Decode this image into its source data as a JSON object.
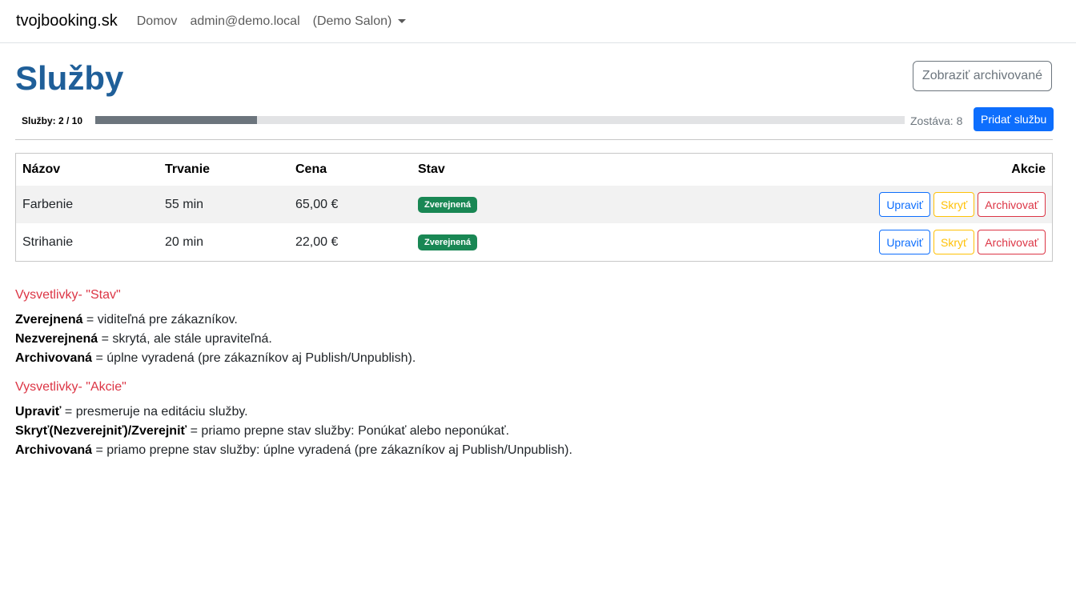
{
  "navbar": {
    "brand": "tvojbooking.sk",
    "home": "Domov",
    "user": "admin@demo.local",
    "salon": "(Demo Salon)"
  },
  "header": {
    "title": "Služby",
    "archived_button": "Zobraziť archivované"
  },
  "quota": {
    "label": "Služby: 2 / 10",
    "used": 2,
    "total": 10,
    "fraction": 0.2,
    "remaining": "Zostáva: 8",
    "add_button": "Pridať službu"
  },
  "table": {
    "columns": [
      "Názov",
      "Trvanie",
      "Cena",
      "Stav",
      "Akcie"
    ],
    "rows": [
      {
        "name": "Farbenie",
        "duration": "55 min",
        "price": "65,00 €",
        "status": "Zverejnená",
        "edit": "Upraviť",
        "hide": "Skryť",
        "archive": "Archivovať"
      },
      {
        "name": "Strihanie",
        "duration": "20 min",
        "price": "22,00 €",
        "status": "Zverejnená",
        "edit": "Upraviť",
        "hide": "Skryť",
        "archive": "Archivovať"
      }
    ]
  },
  "legend_status": {
    "title": "Vysvetlivky- \"Stav\"",
    "items": [
      {
        "term": "Zverejnená",
        "desc": " = viditeľná pre zákazníkov."
      },
      {
        "term": "Nezverejnená",
        "desc": " = skrytá, ale stále upraviteľná."
      },
      {
        "term": "Archivovaná",
        "desc": " = úplne vyradená (pre zákazníkov aj Publish/Unpublish)."
      }
    ]
  },
  "legend_actions": {
    "title": "Vysvetlivky- \"Akcie\"",
    "items": [
      {
        "term": "Upraviť",
        "desc": " = presmeruje na editáciu služby."
      },
      {
        "term": "Skryť(Nezverejniť)/Zverejniť",
        "desc": " = priamo prepne stav služby: Ponúkať alebo neponúkať."
      },
      {
        "term": "Archivovaná",
        "desc": " = priamo prepne stav služby: úplne vyradená (pre zákazníkov aj Publish/Unpublish)."
      }
    ]
  },
  "colors": {
    "title": "#1f5f99",
    "primary": "#0d6efd",
    "success": "#198754",
    "warning": "#ffc107",
    "danger": "#dc3545",
    "secondary": "#6c757d"
  }
}
